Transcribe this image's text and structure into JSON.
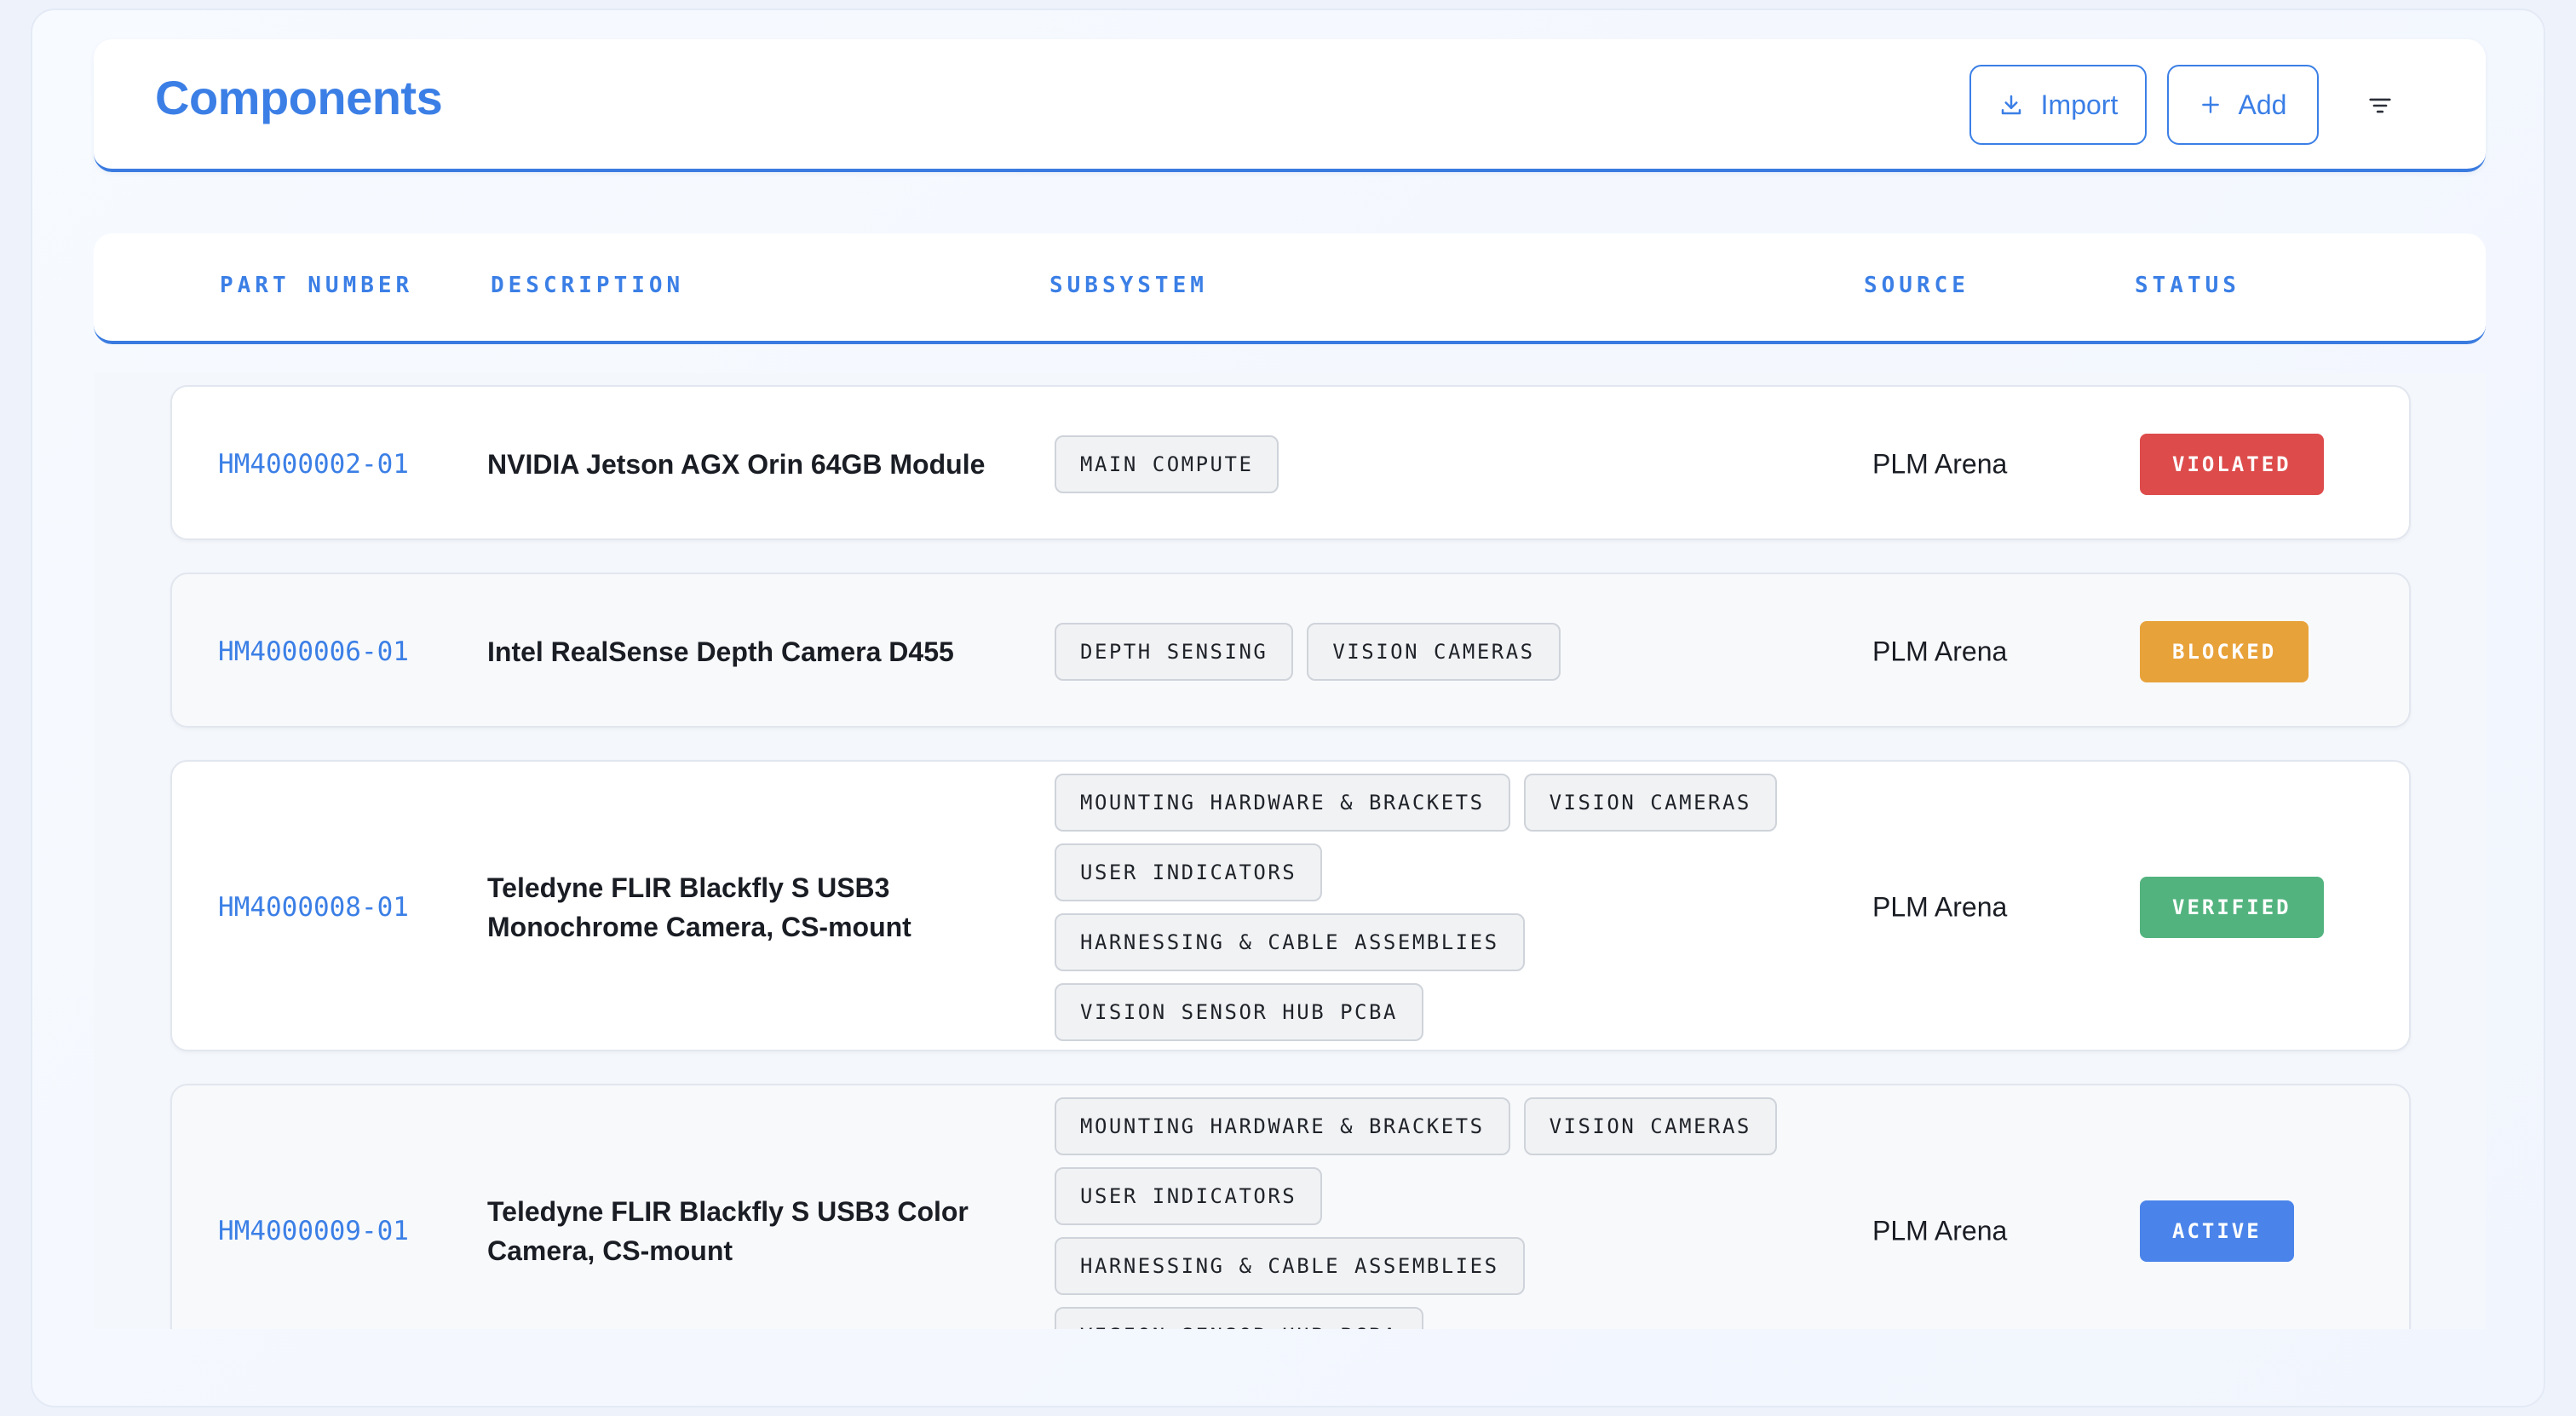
{
  "header": {
    "title": "Components",
    "import_label": "Import",
    "add_label": "Add",
    "accent_color": "#3b7fe6"
  },
  "table": {
    "columns": [
      "PART NUMBER",
      "DESCRIPTION",
      "SUBSYSTEM",
      "SOURCE",
      "STATUS"
    ],
    "rows": [
      {
        "part_number": "HM4000002-01",
        "description": "NVIDIA Jetson AGX Orin 64GB Module",
        "subsystems": [
          "MAIN COMPUTE"
        ],
        "source": "PLM Arena",
        "status": "VIOLATED",
        "status_color": "#dd4b4b"
      },
      {
        "part_number": "HM4000006-01",
        "description": "Intel RealSense Depth Camera D455",
        "subsystems": [
          "DEPTH SENSING",
          "VISION CAMERAS"
        ],
        "source": "PLM Arena",
        "status": "BLOCKED",
        "status_color": "#e8a23a"
      },
      {
        "part_number": "HM4000008-01",
        "description": "Teledyne FLIR Blackfly S USB3 Monochrome Camera, CS-mount",
        "subsystems": [
          "MOUNTING HARDWARE & BRACKETS",
          "VISION CAMERAS",
          "USER INDICATORS",
          "HARNESSING & CABLE ASSEMBLIES",
          "VISION SENSOR HUB PCBA"
        ],
        "source": "PLM Arena",
        "status": "VERIFIED",
        "status_color": "#52b37e"
      },
      {
        "part_number": "HM4000009-01",
        "description": "Teledyne FLIR Blackfly S USB3 Color Camera, CS-mount",
        "subsystems": [
          "MOUNTING HARDWARE & BRACKETS",
          "VISION CAMERAS",
          "USER INDICATORS",
          "HARNESSING & CABLE ASSEMBLIES",
          "VISION SENSOR HUB PCBA"
        ],
        "source": "PLM Arena",
        "status": "ACTIVE",
        "status_color": "#4a84ea"
      }
    ]
  },
  "icons": {
    "import": "download-icon",
    "add": "plus-icon",
    "filter": "filter-icon"
  }
}
